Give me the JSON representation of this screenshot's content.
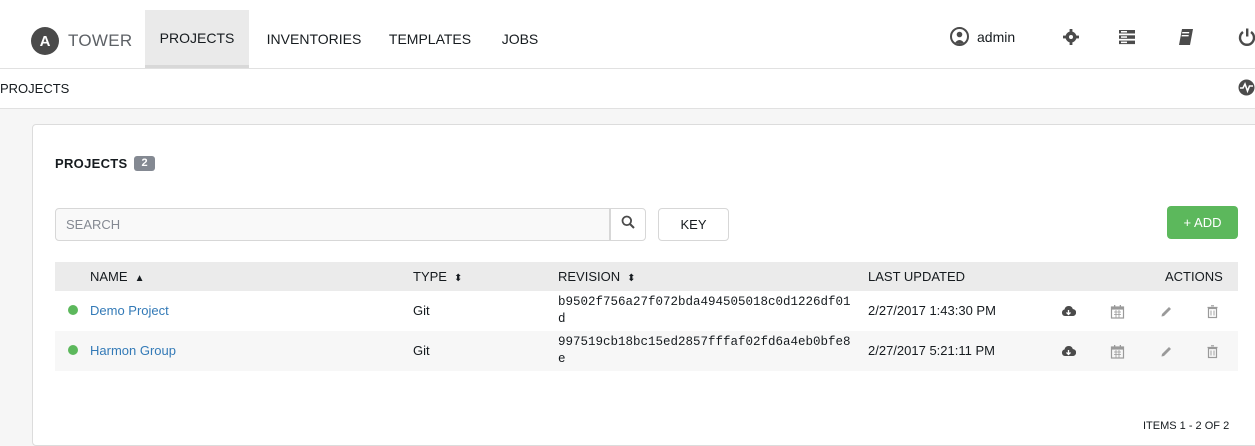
{
  "nav": {
    "brand_mark": "A",
    "brand": "TOWER",
    "tabs": [
      "PROJECTS",
      "INVENTORIES",
      "TEMPLATES",
      "JOBS"
    ],
    "active_tab": "PROJECTS",
    "user": "admin",
    "icons": [
      "user-icon",
      "gear-icon",
      "portal-mode-icon",
      "docs-icon",
      "logout-icon"
    ]
  },
  "breadcrumb": {
    "current": "PROJECTS"
  },
  "card": {
    "title": "PROJECTS",
    "count": "2",
    "search_placeholder": "SEARCH",
    "key_label": "KEY",
    "add_label": "+ ADD"
  },
  "table": {
    "columns": [
      "NAME",
      "TYPE",
      "REVISION",
      "LAST UPDATED",
      "ACTIONS"
    ],
    "rows": [
      {
        "name": "Demo Project",
        "type": "Git",
        "revision": "b9502f756a27f072bda494505018c0d1226df01d",
        "updated": "2/27/2017 1:43:30 PM",
        "status": "successful"
      },
      {
        "name": "Harmon Group",
        "type": "Git",
        "revision": "997519cb18bc15ed2857fffaf02fd6a4eb0bfe8e",
        "updated": "2/27/2017 5:21:11 PM",
        "status": "successful"
      }
    ],
    "items_label": "ITEMS  1 - 2 OF 2"
  },
  "colors": {
    "accent_green": "#5cb85c",
    "link_blue": "#337ab7",
    "status_ok": "#5cb85c"
  }
}
